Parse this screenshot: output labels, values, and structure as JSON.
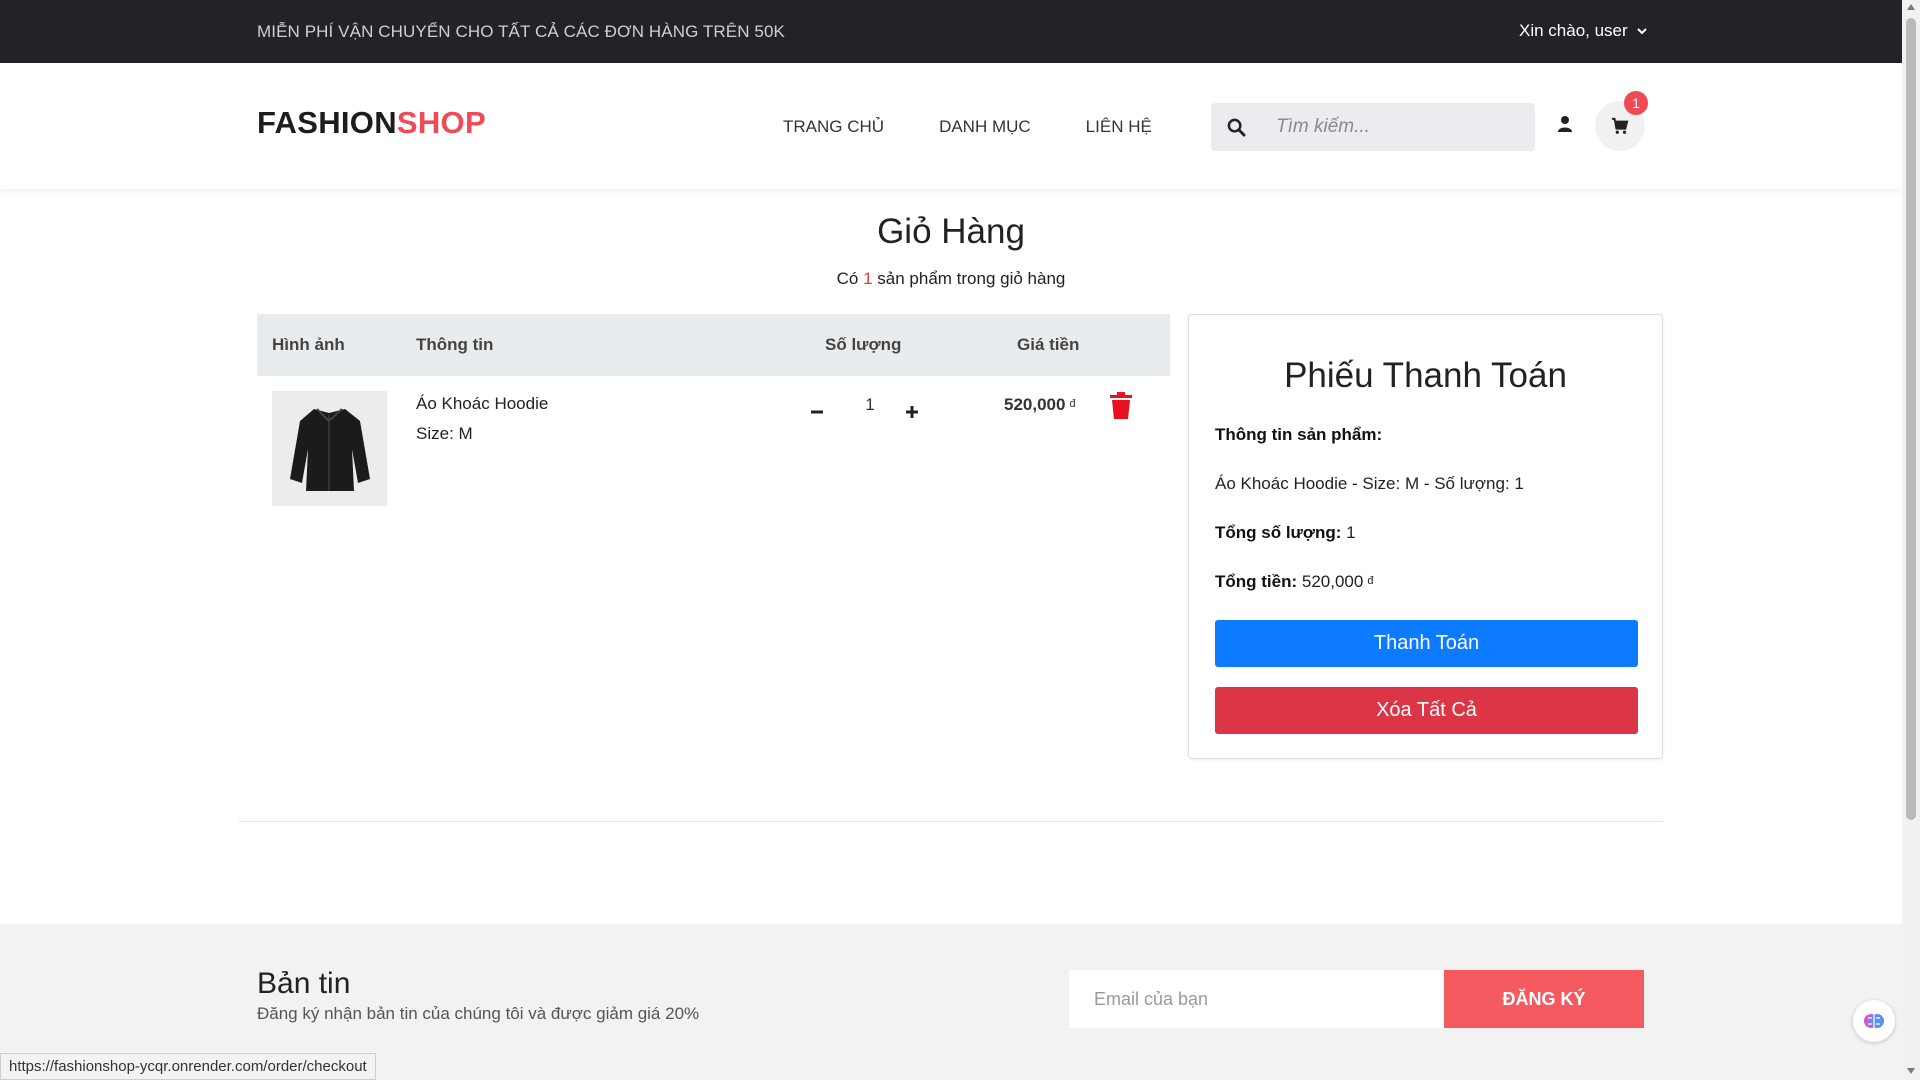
{
  "topbar": {
    "promo": "MIỄN PHÍ VẬN CHUYỂN CHO TẤT CẢ CÁC ĐƠN HÀNG TRÊN 50K",
    "greeting": "Xin chào, user"
  },
  "header": {
    "logo_part1": "FASHION",
    "logo_part2": "SHOP",
    "nav": [
      "TRANG CHỦ",
      "DANH MỤC",
      "LIÊN HỆ"
    ],
    "search_placeholder": "Tìm kiếm...",
    "cart_count": "1"
  },
  "cart": {
    "title": "Giỏ Hàng",
    "subtitle_prefix": "Có",
    "subtitle_count": "1",
    "subtitle_suffix": "sản phẩm trong giỏ hàng",
    "columns": [
      "Hình ảnh",
      "Thông tin",
      "Số lượng",
      "Giá tiền"
    ],
    "items": [
      {
        "name": "Áo Khoác Hoodie",
        "size": "Size: M",
        "quantity": "1",
        "price": "520,000",
        "currency": "đ"
      }
    ]
  },
  "summary": {
    "title": "Phiếu Thanh Toán",
    "product_info_label": "Thông tin sản phẩm:",
    "product_line": "Áo Khoác Hoodie - Size: M - Số lượng: 1",
    "total_qty_label": "Tổng số lượng:",
    "total_qty_value": "1",
    "total_label": "Tổng tiền:",
    "total_value": "520,000",
    "currency": "đ",
    "pay_button": "Thanh Toán",
    "clear_button": "Xóa Tất Cả"
  },
  "newsletter": {
    "title": "Bản tin",
    "subtitle": "Đăng ký nhận bản tin của chúng tôi và được giảm giá 20%",
    "email_placeholder": "Email của bạn",
    "button": "ĐĂNG KÝ"
  },
  "status_url": "https://fashionshop-ycqr.onrender.com/order/checkout",
  "colors": {
    "accent_red": "#ef4a55",
    "pay_blue": "#0d7bff",
    "clear_red": "#dc3545",
    "topbar_bg": "#222328"
  },
  "icons": [
    "chevron-down-icon",
    "search-icon",
    "user-icon",
    "cart-icon",
    "minus-icon",
    "plus-icon",
    "trash-icon",
    "brain-icon"
  ]
}
